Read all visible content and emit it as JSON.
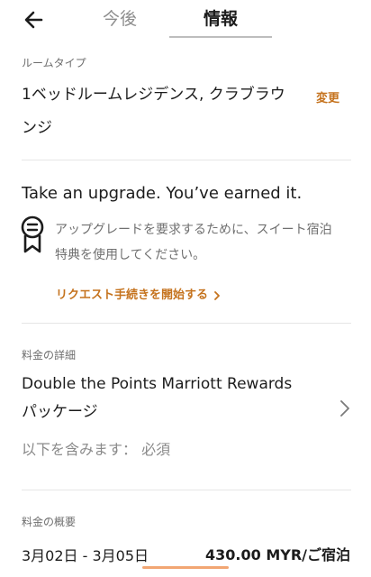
{
  "header": {
    "tabs": [
      {
        "label": "今後",
        "active": false
      },
      {
        "label": "情報",
        "active": true
      }
    ]
  },
  "room": {
    "label": "ルームタイプ",
    "type": "1ベッドルームレジデンス, クラブラウンジ",
    "change": "変更"
  },
  "upgrade": {
    "title": "Take an upgrade. You’ve earned it.",
    "description": "アップグレードを要求するために、スイート宿泊特典を使用してください。",
    "link": "リクエスト手続きを開始する"
  },
  "rate_details": {
    "label": "料金の詳細",
    "name": "Double the Points Marriott Rewards パッケージ",
    "includes": "以下を含みます： 必須"
  },
  "rate_summary": {
    "label": "料金の概要",
    "dates": "3月02日 - 3月05日",
    "price": "430.00 MYR/ご宿泊"
  },
  "colors": {
    "accent": "#c5731e",
    "muted": "#8a8a8a"
  }
}
